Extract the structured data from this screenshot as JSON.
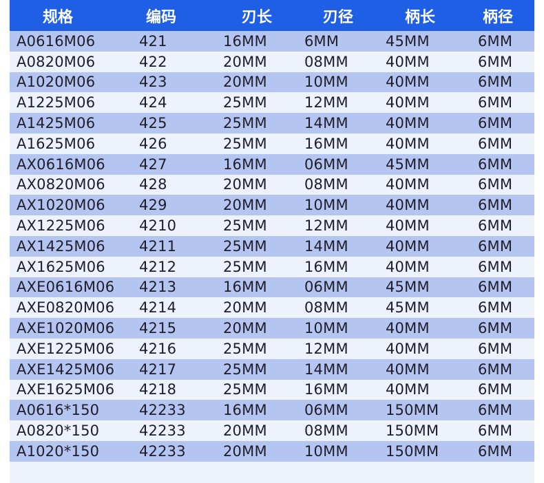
{
  "table": {
    "headers": [
      "规格",
      "编码",
      "刃长",
      "刃径",
      "柄长",
      "柄径"
    ],
    "rows": [
      [
        "A0616M06",
        "421",
        "16MM",
        "6MM",
        "45MM",
        "6MM"
      ],
      [
        "A0820M06",
        "422",
        "20MM",
        "08MM",
        "40MM",
        "6MM"
      ],
      [
        "A1020M06",
        "423",
        "20MM",
        "10MM",
        "40MM",
        "6MM"
      ],
      [
        "A1225M06",
        "424",
        "25MM",
        "12MM",
        "40MM",
        "6MM"
      ],
      [
        "A1425M06",
        "425",
        "25MM",
        "14MM",
        "40MM",
        "6MM"
      ],
      [
        "A1625M06",
        "426",
        "25MM",
        "16MM",
        "40MM",
        "6MM"
      ],
      [
        "AX0616M06",
        "427",
        "16MM",
        "06MM",
        "45MM",
        "6MM"
      ],
      [
        "AX0820M06",
        "428",
        "20MM",
        "08MM",
        "40MM",
        "6MM"
      ],
      [
        "AX1020M06",
        "429",
        "20MM",
        "10MM",
        "40MM",
        "6MM"
      ],
      [
        "AX1225M06",
        "4210",
        "25MM",
        "12MM",
        "40MM",
        "6MM"
      ],
      [
        "AX1425M06",
        "4211",
        "25MM",
        "14MM",
        "40MM",
        "6MM"
      ],
      [
        "AX1625M06",
        "4212",
        "25MM",
        "16MM",
        "40MM",
        "6MM"
      ],
      [
        "AXE0616M06",
        "4213",
        "16MM",
        "06MM",
        "45MM",
        "6MM"
      ],
      [
        "AXE0820M06",
        "4214",
        "20MM",
        "08MM",
        "45MM",
        "6MM"
      ],
      [
        "AXE1020M06",
        "4215",
        "20MM",
        "10MM",
        "40MM",
        "6MM"
      ],
      [
        "AXE1225M06",
        "4216",
        "25MM",
        "12MM",
        "40MM",
        "6MM"
      ],
      [
        "AXE1425M06",
        "4217",
        "25MM",
        "14MM",
        "40MM",
        "6MM"
      ],
      [
        "AXE1625M06",
        "4218",
        "25MM",
        "16MM",
        "40MM",
        "6MM"
      ],
      [
        "A0616*150",
        "42233",
        "16MM",
        "06MM",
        "150MM",
        "6MM"
      ],
      [
        "A0820*150",
        "42233",
        "20MM",
        "08MM",
        "150MM",
        "6MM"
      ],
      [
        "A1020*150",
        "42233",
        "20MM",
        "10MM",
        "150MM",
        "6MM"
      ]
    ]
  },
  "colors": {
    "header_bg": "#1f5fe6",
    "row_odd": "#b4c5f2",
    "row_even": "#eef2fb"
  }
}
